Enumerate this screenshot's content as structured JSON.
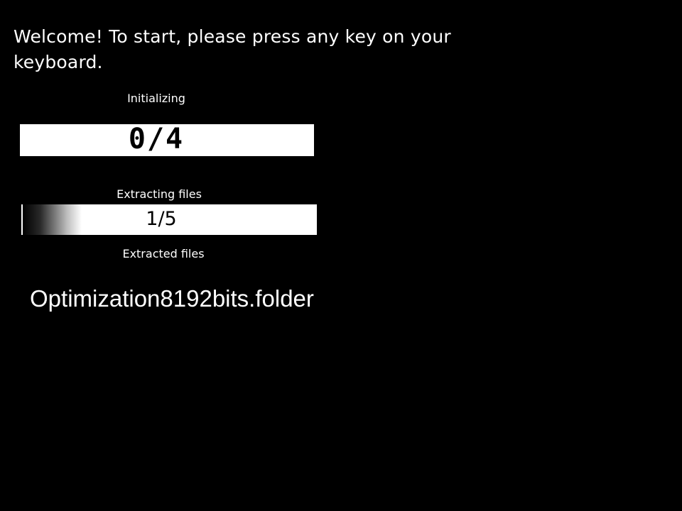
{
  "welcome": {
    "message": "Welcome! To start, please press any key on your keyboard."
  },
  "initializing": {
    "label": "Initializing",
    "counter": "0/4",
    "progress": 0
  },
  "extracting": {
    "label": "Extracting files",
    "counter": "1/5",
    "progress": 0.2
  },
  "extracted": {
    "label": "Extracted files"
  },
  "current_file": {
    "name": "Optimization8192bits.folder"
  },
  "colors": {
    "background": "#000000",
    "foreground": "#ffffff",
    "bar_text": "#000000"
  }
}
